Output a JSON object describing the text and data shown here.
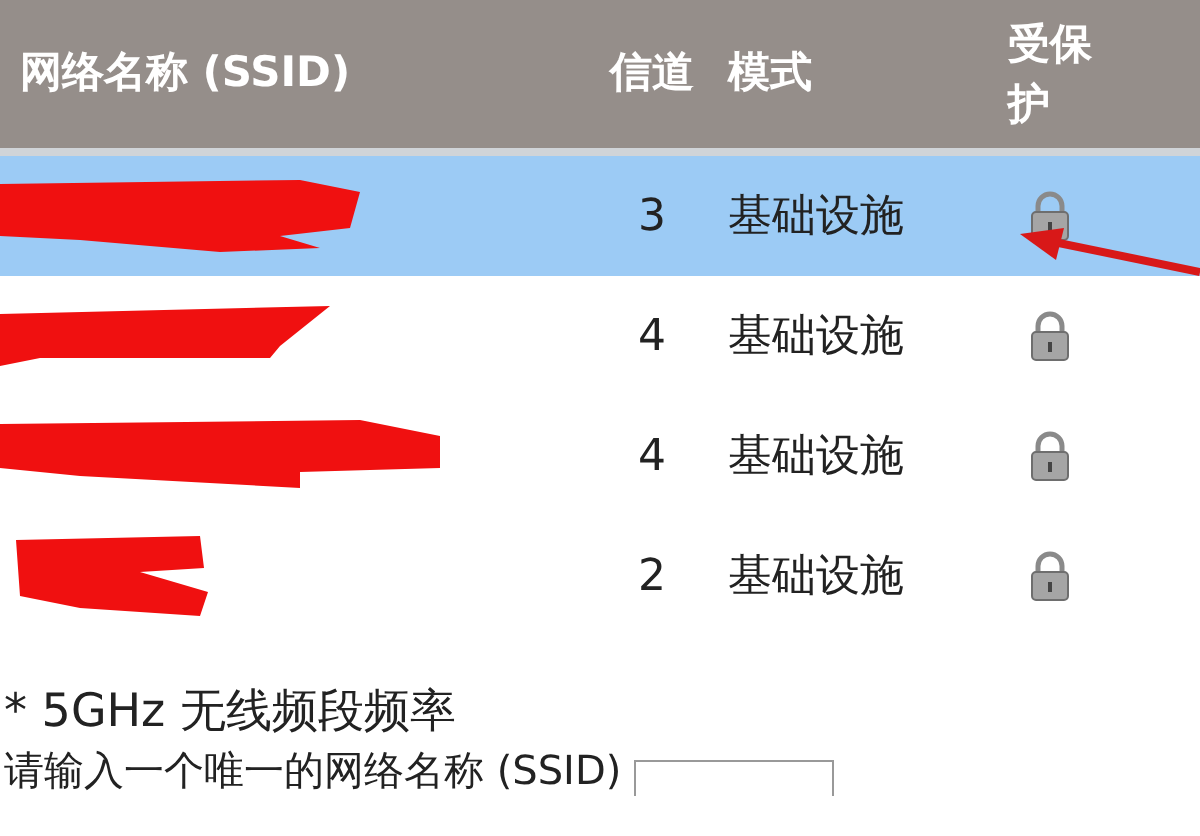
{
  "table": {
    "columns": [
      "网络名称 (SSID)",
      "信道",
      "模式",
      "受保护"
    ],
    "rows": [
      {
        "redacted": true,
        "channel": "3",
        "mode": "基础设施",
        "secured": true,
        "selected": true
      },
      {
        "redacted": true,
        "channel": "4",
        "mode": "基础设施",
        "secured": true,
        "selected": false
      },
      {
        "redacted": true,
        "channel": "4",
        "mode": "基础设施",
        "secured": true,
        "selected": false
      },
      {
        "redacted": true,
        "channel": "2",
        "mode": "基础设施",
        "secured": true,
        "selected": false
      }
    ]
  },
  "annotation": {
    "arrow": true
  },
  "band_note": "* 5GHz 无线频段频率",
  "instruction": "请输入一个唯一的网络名称 (SSID)"
}
